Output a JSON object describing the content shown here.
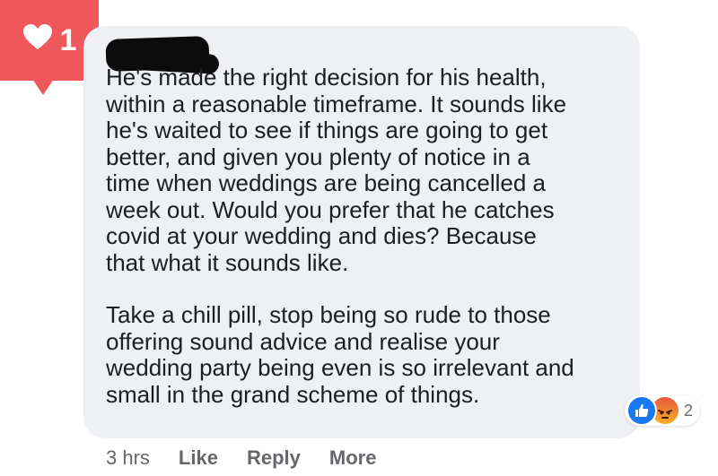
{
  "notification": {
    "icon": "heart-icon",
    "count": "1"
  },
  "comment": {
    "paragraphs": [
      [
        "He's made the right decision for his health,",
        "within a reasonable timeframe. It sounds like",
        "he's waited to see if things are going to get",
        "better, and given you plenty of notice in a",
        "time when weddings are being cancelled a",
        "week out. Would you prefer that he catches",
        "covid at your wedding and dies? Because",
        "that what it sounds like."
      ],
      [
        "Take a chill pill, stop being so rude to those",
        "offering sound advice and realise your",
        "wedding party being even is so irrelevant and",
        "small in the grand scheme of things."
      ]
    ]
  },
  "reactions": {
    "icons": [
      "like-icon",
      "angry-icon"
    ],
    "count": "2"
  },
  "actions": {
    "time": "3 hrs",
    "like": "Like",
    "reply": "Reply",
    "more": "More"
  },
  "colors": {
    "badge": "#f0585b",
    "bubble": "#eef0f3",
    "like_blue": "#1877f2",
    "meta_gray": "#65676b"
  }
}
